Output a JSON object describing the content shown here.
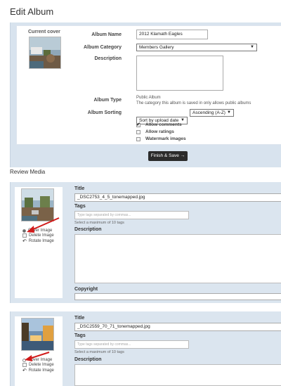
{
  "page": {
    "title": "Edit Album"
  },
  "album": {
    "cover_label": "Current cover",
    "name_label": "Album Name",
    "name_value": "2012 Klamath Eagles",
    "category_label": "Album Category",
    "category_value": "Members Gallery",
    "description_label": "Description",
    "type_label": "Album Type",
    "type_value": "Public Album",
    "type_note": "The category this album is saved in only allows public albums",
    "sorting_label": "Album Sorting",
    "sort_by_value": "Sort by upload date",
    "sort_order_value": "Ascending (A-Z)",
    "options": [
      {
        "label": "Allow comments",
        "checked": true
      },
      {
        "label": "Allow ratings",
        "checked": false
      },
      {
        "label": "Watermark images",
        "checked": false
      }
    ],
    "finish_button": "Finish & Save →"
  },
  "review": {
    "title": "Review Media",
    "labels": {
      "title": "Title",
      "tags": "Tags",
      "tags_placeholder": "Type tags separated by commas...",
      "tags_hint": "Select a maximum of 10 tags",
      "description": "Description",
      "copyright": "Copyright",
      "cover_image": "Cover Image",
      "delete_image": "Delete Image",
      "rotate_image": "Rotate Image"
    },
    "items": [
      {
        "title_value": "_DSC2753_4_5_tonemapped.jpg"
      },
      {
        "title_value": "_DSC2559_70_71_tonemapped.jpg"
      }
    ]
  },
  "colors": {
    "panel_bg": "#dbe5ef",
    "button_bg": "#2b2b2b",
    "annotation_red": "#d11a1a"
  },
  "icons": {
    "rotate": "rotate-icon",
    "dropdown": "chevron-down-icon"
  }
}
